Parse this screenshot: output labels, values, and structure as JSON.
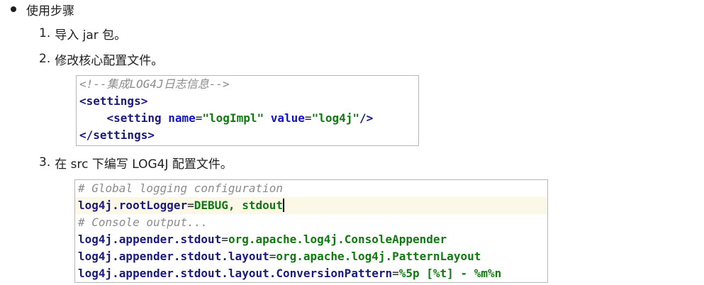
{
  "section": {
    "title": "使用步骤"
  },
  "steps": [
    {
      "num": "1.",
      "text": "导入 jar 包。"
    },
    {
      "num": "2.",
      "text": "修改核心配置文件。"
    },
    {
      "num": "3.",
      "text": "在 src 下编写 LOG4J 配置文件。"
    }
  ],
  "xml_code": {
    "comment": "<!--集成LOG4J日志信息-->",
    "settings_open": "<settings>",
    "setting_open": "<setting",
    "attr_name": "name",
    "eq": "=",
    "name_value": "\"logImpl\"",
    "attr_value": "value",
    "value_value": "\"log4j\"",
    "self_close": "/>",
    "settings_close": "</settings>"
  },
  "props_code": {
    "comment1": "# Global logging configuration",
    "line1_key": "log4j.rootLogger",
    "line1_val": "DEBUG, stdout",
    "comment2": "# Console output...",
    "line2_key": "log4j.appender.stdout",
    "line2_val": "org.apache.log4j.ConsoleAppender",
    "line3_key": "log4j.appender.stdout.layout",
    "line3_val": "org.apache.log4j.PatternLayout",
    "line4_key": "log4j.appender.stdout.layout.ConversionPattern",
    "line4_val": "%5p [%t] - %m%n",
    "eq": "="
  },
  "colors": {
    "tag": "#1a1a80",
    "string": "#107a10",
    "comment": "#8c8c8c",
    "highlight": "#fbf8e8"
  }
}
